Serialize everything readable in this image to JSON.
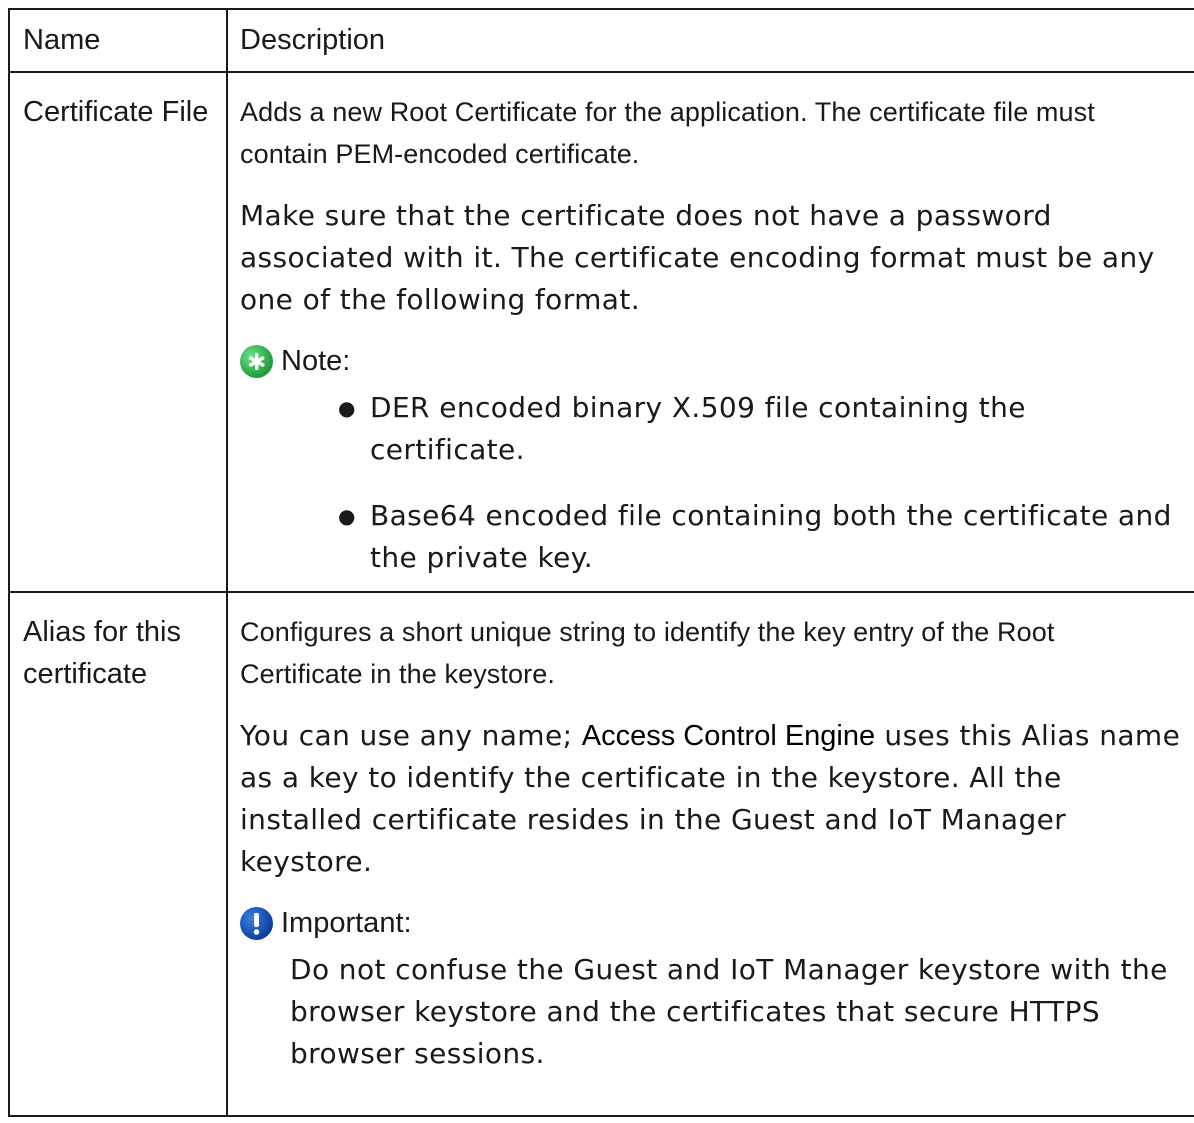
{
  "table": {
    "headers": {
      "name": "Name",
      "description": "Description"
    },
    "rows": [
      {
        "name": "Certificate File",
        "paragraphs": [
          "Adds a new Root Certificate for the application. The certificate file must contain PEM-encoded certificate.",
          "Make sure that the certificate does not have a password associated with it. The certificate encoding format must be any one of the following format."
        ],
        "note": {
          "label": "Note:",
          "icon": "note-star-icon",
          "items": [
            "DER encoded binary X.509 file containing the certificate.",
            "Base64 encoded file containing both the certificate and the private key."
          ]
        }
      },
      {
        "name": "Alias for this certificate",
        "paragraphs": [
          "Configures a short unique string to identify the key entry of the Root Certificate in the keystore."
        ],
        "paragraph2": {
          "before": "You can use any name; ",
          "product": "Access Control Engine",
          "after": " uses this Alias name as a key to identify the certificate in the keystore. All the installed certificate resides in the Guest and IoT Manager keystore."
        },
        "important": {
          "label": "Important:",
          "icon": "important-exclamation-icon",
          "text": "Do not confuse the Guest and IoT Manager keystore with the browser keystore and the certificates that secure HTTPS browser sessions."
        }
      }
    ]
  },
  "colors": {
    "note_icon": "#2aa84a",
    "important_icon": "#0b3fa0",
    "border": "#1a1a1a",
    "text": "#1a1a1a"
  }
}
